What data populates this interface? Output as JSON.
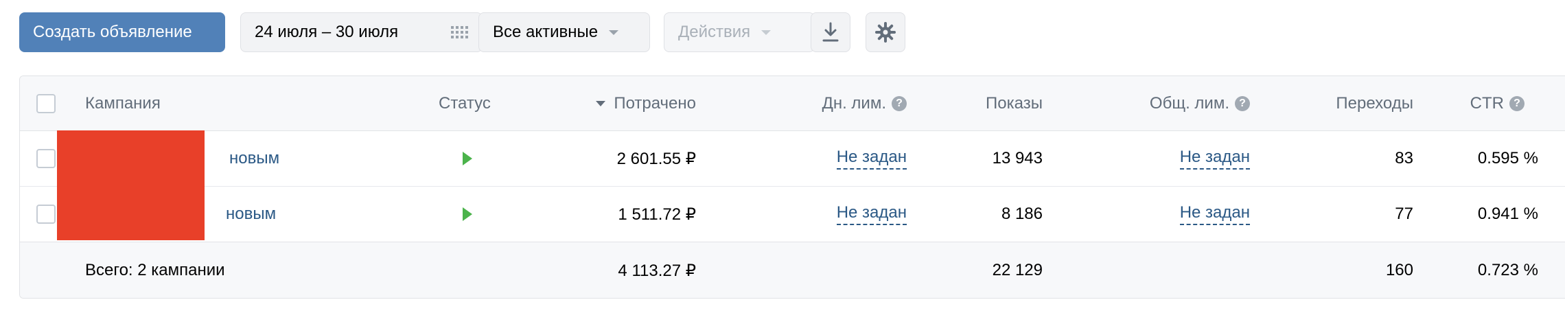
{
  "toolbar": {
    "create_label": "Создать объявление",
    "date_range": "24 июля – 30 июля",
    "filter_label": "Все активные",
    "actions_label": "Действия",
    "download_icon": "download-icon",
    "settings_icon": "gear-icon"
  },
  "table": {
    "headers": {
      "campaign": "Кампания",
      "status": "Статус",
      "spent": "Потрачено",
      "daily_limit": "Дн. лим.",
      "impressions": "Показы",
      "total_limit": "Общ. лим.",
      "clicks": "Переходы",
      "ctr": "CTR"
    },
    "rows": [
      {
        "name": "новым",
        "status": "running",
        "spent": "2 601.55 ₽",
        "daily_limit": "Не задан",
        "impressions": "13 943",
        "total_limit": "Не задан",
        "clicks": "83",
        "ctr": "0.595 %"
      },
      {
        "name": "новым",
        "status": "running",
        "spent": "1 511.72 ₽",
        "daily_limit": "Не задан",
        "impressions": "8 186",
        "total_limit": "Не задан",
        "clicks": "77",
        "ctr": "0.941 %"
      }
    ],
    "total": {
      "label": "Всего: 2 кампании",
      "spent": "4 113.27 ₽",
      "impressions": "22 129",
      "clicks": "160",
      "ctr": "0.723 %"
    }
  },
  "colors": {
    "primary": "#5181b8",
    "link": "#2a5885",
    "status_running": "#4bb34b",
    "redaction": "#e84029"
  }
}
